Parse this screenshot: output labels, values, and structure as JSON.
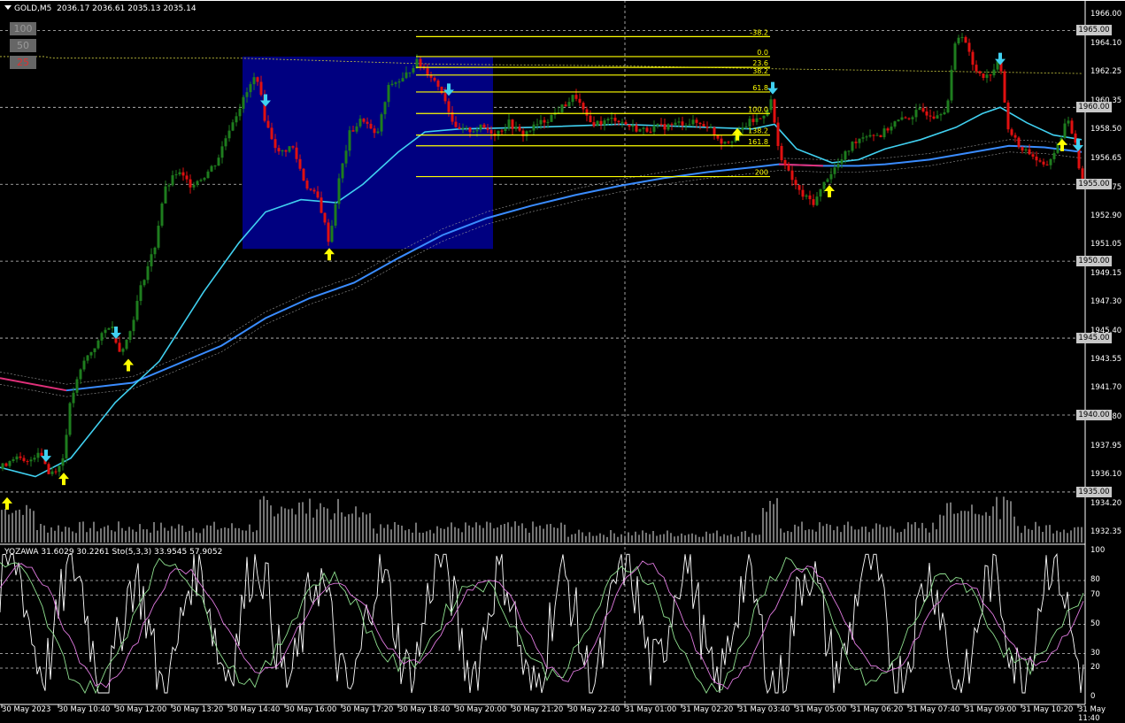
{
  "chart_header": {
    "symbol_timeframe": "GOLD,M5",
    "ohlc": "2036.17 2036.61 2035.13 2035.14"
  },
  "level_buttons": [
    "100",
    "50",
    "25"
  ],
  "indicator_header": "YOZAWA 31.6029 30.2261  Sto(5,3,3) 33.9545 57.9052",
  "price_axis": {
    "ticks": [
      "1966.00",
      "1964.10",
      "1962.25",
      "1960.35",
      "1958.50",
      "1956.65",
      "1954.75",
      "1952.90",
      "1951.05",
      "1949.15",
      "1947.30",
      "1945.40",
      "1943.55",
      "1941.70",
      "1939.80",
      "1937.95",
      "1936.10",
      "1934.20",
      "1932.35"
    ],
    "boxed_levels": [
      "1965.00",
      "1960.00",
      "1955.00",
      "1950.00",
      "1945.00",
      "1940.00",
      "1935.00"
    ]
  },
  "oscillator_axis": {
    "ticks": [
      "100",
      "80",
      "70",
      "50",
      "30",
      "20",
      "0"
    ]
  },
  "time_axis": {
    "ticks": [
      "30 May 2023",
      "30 May 10:40",
      "30 May 12:00",
      "30 May 13:20",
      "30 May 14:40",
      "30 May 16:00",
      "30 May 17:20",
      "30 May 18:40",
      "30 May 20:00",
      "30 May 21:20",
      "30 May 22:40",
      "31 May 01:00",
      "31 May 02:20",
      "31 May 03:40",
      "31 May 05:00",
      "31 May 06:20",
      "31 May 07:40",
      "31 May 09:00",
      "31 May 10:20",
      "31 May 11:40"
    ]
  },
  "fibonacci": {
    "levels": [
      "-38.2",
      "0.0",
      "23.6",
      "38.2",
      "61.8",
      "100.0",
      "138.2",
      "161.8",
      "200"
    ]
  },
  "colors": {
    "background": "#000000",
    "bull_candle": "#1e7d1e",
    "bear_candle": "#e01010",
    "fib": "#ffff00",
    "fast_ma": "#40d0f0",
    "slow_ma": "#3a8cff",
    "slow_ma_early": "#e0307a",
    "zone_box": "#000080",
    "arrow_up": "#ffff00",
    "arrow_down": "#40d0f0",
    "osc_fast": "#ffffff",
    "osc_k": "#8fe08f",
    "osc_d": "#e07ae0"
  },
  "chart_data": {
    "type": "candlestick",
    "symbol": "GOLD",
    "timeframe": "M5",
    "ylim": [
      1932.35,
      1966.0
    ],
    "price_path": [
      [
        0,
        1936.5
      ],
      [
        15,
        1937.3
      ],
      [
        30,
        1936.8
      ],
      [
        45,
        1937.8
      ],
      [
        55,
        1936.2
      ],
      [
        70,
        1936.8
      ],
      [
        80,
        1941.0
      ],
      [
        95,
        1943.5
      ],
      [
        110,
        1944.7
      ],
      [
        125,
        1946.0
      ],
      [
        135,
        1944.2
      ],
      [
        145,
        1945.0
      ],
      [
        160,
        1948.5
      ],
      [
        175,
        1951.0
      ],
      [
        185,
        1954.5
      ],
      [
        200,
        1955.8
      ],
      [
        215,
        1955.0
      ],
      [
        230,
        1955.5
      ],
      [
        245,
        1956.5
      ],
      [
        260,
        1958.8
      ],
      [
        275,
        1960.5
      ],
      [
        290,
        1962.2
      ],
      [
        300,
        1959.0
      ],
      [
        315,
        1957.0
      ],
      [
        330,
        1957.5
      ],
      [
        345,
        1955.0
      ],
      [
        360,
        1954.0
      ],
      [
        372,
        1951.2
      ],
      [
        382,
        1955.0
      ],
      [
        395,
        1958.3
      ],
      [
        410,
        1959.3
      ],
      [
        425,
        1958.0
      ],
      [
        440,
        1961.5
      ],
      [
        455,
        1961.8
      ],
      [
        470,
        1963.0
      ],
      [
        485,
        1962.2
      ],
      [
        500,
        1961.0
      ],
      [
        515,
        1958.5
      ],
      [
        530,
        1958.5
      ],
      [
        545,
        1958.7
      ],
      [
        560,
        1958.3
      ],
      [
        575,
        1959.0
      ],
      [
        590,
        1958.2
      ],
      [
        605,
        1958.8
      ],
      [
        620,
        1959.3
      ],
      [
        635,
        1960.0
      ],
      [
        650,
        1960.8
      ],
      [
        665,
        1959.0
      ],
      [
        680,
        1959.0
      ],
      [
        695,
        1959.3
      ],
      [
        710,
        1958.8
      ],
      [
        725,
        1958.5
      ],
      [
        740,
        1958.7
      ],
      [
        755,
        1958.8
      ],
      [
        770,
        1959.0
      ],
      [
        785,
        1959.0
      ],
      [
        800,
        1958.8
      ],
      [
        815,
        1957.8
      ],
      [
        830,
        1958.0
      ],
      [
        845,
        1959.0
      ],
      [
        860,
        1959.3
      ],
      [
        872,
        1960.5
      ],
      [
        878,
        1957.5
      ],
      [
        890,
        1955.8
      ],
      [
        905,
        1954.3
      ],
      [
        920,
        1953.8
      ],
      [
        935,
        1955.5
      ],
      [
        950,
        1956.5
      ],
      [
        965,
        1957.8
      ],
      [
        980,
        1958.3
      ],
      [
        995,
        1958.2
      ],
      [
        1010,
        1959.0
      ],
      [
        1025,
        1959.3
      ],
      [
        1040,
        1959.8
      ],
      [
        1055,
        1959.5
      ],
      [
        1070,
        1960.0
      ],
      [
        1080,
        1964.5
      ],
      [
        1088,
        1964.8
      ],
      [
        1100,
        1962.5
      ],
      [
        1115,
        1962.0
      ],
      [
        1130,
        1963.0
      ],
      [
        1137,
        1959.0
      ],
      [
        1150,
        1957.5
      ],
      [
        1165,
        1957.0
      ],
      [
        1180,
        1956.0
      ],
      [
        1195,
        1957.5
      ],
      [
        1205,
        1959.2
      ],
      [
        1215,
        1957.8
      ],
      [
        1222,
        1955.0
      ]
    ],
    "ema_fast": [
      [
        0,
        1936.6
      ],
      [
        40,
        1936.0
      ],
      [
        80,
        1937.2
      ],
      [
        130,
        1940.8
      ],
      [
        180,
        1943.5
      ],
      [
        230,
        1948.0
      ],
      [
        270,
        1951.2
      ],
      [
        300,
        1953.2
      ],
      [
        340,
        1954.0
      ],
      [
        380,
        1953.8
      ],
      [
        410,
        1955.0
      ],
      [
        450,
        1957.1
      ],
      [
        480,
        1958.4
      ],
      [
        520,
        1958.6
      ],
      [
        600,
        1958.7
      ],
      [
        700,
        1958.9
      ],
      [
        800,
        1958.7
      ],
      [
        850,
        1958.6
      ],
      [
        875,
        1958.9
      ],
      [
        900,
        1957.3
      ],
      [
        940,
        1956.4
      ],
      [
        970,
        1956.6
      ],
      [
        1000,
        1957.3
      ],
      [
        1040,
        1957.9
      ],
      [
        1080,
        1958.7
      ],
      [
        1110,
        1959.6
      ],
      [
        1130,
        1960.0
      ],
      [
        1160,
        1959.0
      ],
      [
        1190,
        1958.2
      ],
      [
        1222,
        1957.9
      ]
    ],
    "ema_slow": [
      [
        0,
        1942.4
      ],
      [
        75,
        1941.6
      ],
      [
        150,
        1942.1
      ],
      [
        250,
        1944.5
      ],
      [
        300,
        1946.3
      ],
      [
        350,
        1947.6
      ],
      [
        400,
        1948.6
      ],
      [
        450,
        1950.2
      ],
      [
        500,
        1951.7
      ],
      [
        550,
        1952.8
      ],
      [
        600,
        1953.6
      ],
      [
        650,
        1954.3
      ],
      [
        700,
        1954.9
      ],
      [
        750,
        1955.4
      ],
      [
        800,
        1955.8
      ],
      [
        850,
        1956.1
      ],
      [
        880,
        1956.3
      ],
      [
        930,
        1956.2
      ],
      [
        970,
        1956.2
      ],
      [
        1000,
        1956.3
      ],
      [
        1050,
        1956.6
      ],
      [
        1100,
        1957.1
      ],
      [
        1140,
        1957.5
      ],
      [
        1180,
        1957.4
      ],
      [
        1222,
        1957.1
      ]
    ],
    "yellow_dotted_ma": [
      [
        0,
        1963.3
      ],
      [
        50,
        1963.3
      ],
      [
        60,
        1963.2
      ],
      [
        270,
        1963.2
      ],
      [
        500,
        1962.8
      ],
      [
        700,
        1962.7
      ],
      [
        880,
        1962.5
      ],
      [
        1000,
        1962.4
      ],
      [
        1222,
        1962.2
      ]
    ],
    "zone_box": {
      "x0": 274,
      "x1": 557,
      "top": 1963.3,
      "bottom": 1950.8
    },
    "fib_values": [
      1964.6,
      1963.3,
      1962.6,
      1962.1,
      1961.0,
      1959.6,
      1958.2,
      1957.5,
      1955.5
    ],
    "arrows_up": [
      [
        8,
        1935.0
      ],
      [
        72,
        1936.6
      ],
      [
        145,
        1944.0
      ],
      [
        372,
        1951.2
      ],
      [
        833,
        1959.0
      ],
      [
        937,
        1955.3
      ],
      [
        1200,
        1958.3
      ]
    ],
    "arrows_down": [
      [
        52,
        1936.6
      ],
      [
        131,
        1944.6
      ],
      [
        300,
        1959.7
      ],
      [
        507,
        1960.4
      ],
      [
        873,
        1960.5
      ],
      [
        1130,
        1962.4
      ],
      [
        1218,
        1956.8
      ]
    ]
  }
}
